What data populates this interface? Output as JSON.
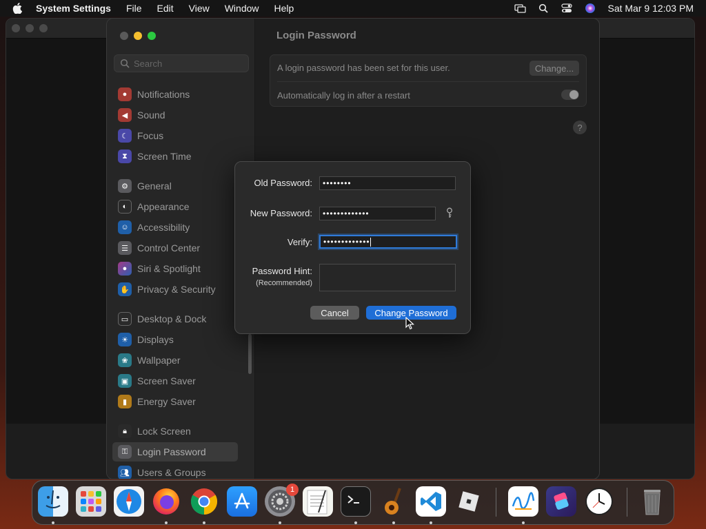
{
  "menubar": {
    "app_name": "System Settings",
    "items": [
      "File",
      "Edit",
      "View",
      "Window",
      "Help"
    ],
    "clock": "Sat Mar 9  12:03 PM"
  },
  "sidebar": {
    "search_placeholder": "Search",
    "items": [
      {
        "label": "Notifications",
        "icon": "bell-icon",
        "color": "#e5483b"
      },
      {
        "label": "Sound",
        "icon": "speaker-icon",
        "color": "#e5483b"
      },
      {
        "label": "Focus",
        "icon": "moon-icon",
        "color": "#5e5ce6"
      },
      {
        "label": "Screen Time",
        "icon": "hourglass-icon",
        "color": "#5e5ce6"
      },
      {
        "label": "General",
        "icon": "gear-icon",
        "color": "#8e8e93"
      },
      {
        "label": "Appearance",
        "icon": "appearance-icon",
        "color": "#1c1c1e"
      },
      {
        "label": "Accessibility",
        "icon": "accessibility-icon",
        "color": "#0a84ff"
      },
      {
        "label": "Control Center",
        "icon": "control-center-icon",
        "color": "#8e8e93"
      },
      {
        "label": "Siri & Spotlight",
        "icon": "siri-icon",
        "color": "#bf5af2"
      },
      {
        "label": "Privacy & Security",
        "icon": "hand-icon",
        "color": "#0a84ff"
      },
      {
        "label": "Desktop & Dock",
        "icon": "dock-icon",
        "color": "#1c1c1e"
      },
      {
        "label": "Displays",
        "icon": "sun-icon",
        "color": "#0a84ff"
      },
      {
        "label": "Wallpaper",
        "icon": "wallpaper-icon",
        "color": "#30b0c7"
      },
      {
        "label": "Screen Saver",
        "icon": "screensaver-icon",
        "color": "#30b0c7"
      },
      {
        "label": "Energy Saver",
        "icon": "battery-icon",
        "color": "#ff9f0a"
      },
      {
        "label": "Lock Screen",
        "icon": "lock-icon",
        "color": "#1c1c1e"
      },
      {
        "label": "Login Password",
        "icon": "key-icon",
        "color": "#8e8e93"
      },
      {
        "label": "Users & Groups",
        "icon": "users-icon",
        "color": "#0a84ff"
      }
    ]
  },
  "content": {
    "title": "Login Password",
    "password_set_text": "A login password has been set for this user.",
    "change_button": "Change...",
    "auto_login_text": "Automatically log in after a restart",
    "help": "?"
  },
  "dialog": {
    "old_password_label": "Old Password:",
    "old_password_value": "••••••••",
    "new_password_label": "New Password:",
    "new_password_value": "•••••••••••••",
    "verify_label": "Verify:",
    "verify_value": "•••••••••••••",
    "hint_label": "Password Hint:",
    "hint_sublabel": "(Recommended)",
    "hint_value": "",
    "cancel_button": "Cancel",
    "change_password_button": "Change Password"
  },
  "dock": {
    "apps": [
      {
        "name": "Finder",
        "icon": "finder-icon",
        "running": true
      },
      {
        "name": "Launchpad",
        "icon": "launchpad-icon",
        "running": false
      },
      {
        "name": "Safari",
        "icon": "safari-icon",
        "running": false
      },
      {
        "name": "Firefox",
        "icon": "firefox-icon",
        "running": true
      },
      {
        "name": "Chrome",
        "icon": "chrome-icon",
        "running": true
      },
      {
        "name": "App Store",
        "icon": "app-store-icon",
        "running": false
      },
      {
        "name": "System Settings",
        "icon": "system-settings-icon",
        "running": true,
        "badge": "1"
      },
      {
        "name": "TextEdit",
        "icon": "textedit-icon",
        "running": false
      },
      {
        "name": "Terminal",
        "icon": "terminal-icon",
        "running": true
      },
      {
        "name": "GarageBand",
        "icon": "garageband-icon",
        "running": true
      },
      {
        "name": "VS Code",
        "icon": "vscode-icon",
        "running": true
      },
      {
        "name": "Roblox",
        "icon": "roblox-icon",
        "running": false
      },
      {
        "name": "Freeform",
        "icon": "freeform-icon",
        "running": true
      },
      {
        "name": "Shortcuts",
        "icon": "shortcuts-icon",
        "running": false
      },
      {
        "name": "Clock",
        "icon": "clock-icon",
        "running": false
      },
      {
        "name": "Trash",
        "icon": "trash-icon",
        "running": false
      }
    ]
  }
}
